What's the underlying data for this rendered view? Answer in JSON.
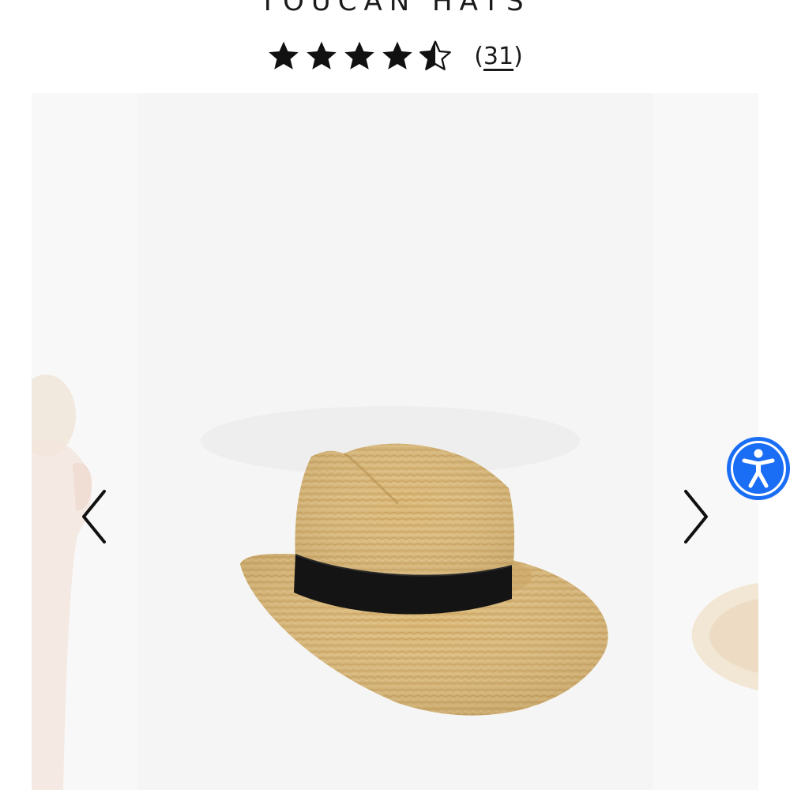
{
  "product": {
    "brand": "TOUCAN HATS",
    "rating": 4.5,
    "rating_max": 5,
    "review_count_open": "(",
    "review_count": "31",
    "review_count_close": ")"
  },
  "carousel": {
    "main_image": "straw-fedora-black-band",
    "prev_icon": "chevron-left-icon",
    "next_icon": "chevron-right-icon"
  },
  "accessibility": {
    "icon": "accessibility-person-icon",
    "color": "#1a6ef5"
  },
  "colors": {
    "star": "#111111",
    "straw": "#d9b779",
    "band": "#141414"
  }
}
